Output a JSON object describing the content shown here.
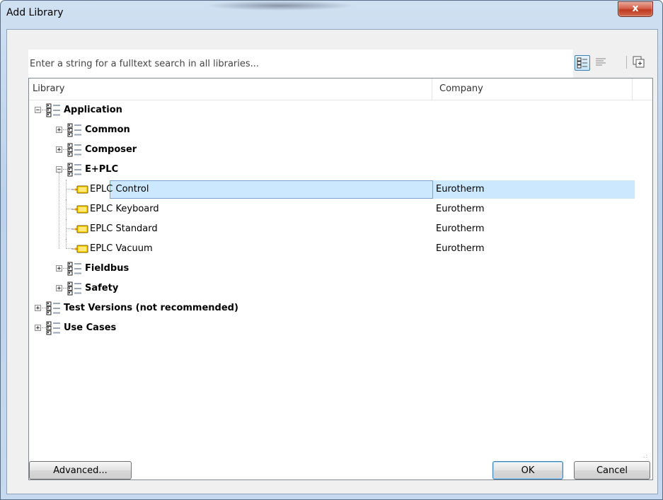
{
  "window": {
    "title": "Add Library",
    "close_glyph": "x"
  },
  "search": {
    "placeholder": "Enter a string for a fulltext search in all libraries..."
  },
  "toolbar": {
    "buttons": [
      {
        "icon": "category-view-icon",
        "active": true
      },
      {
        "icon": "list-view-icon",
        "active": false
      },
      {
        "icon": "expand-all-icon",
        "active": false
      }
    ]
  },
  "list": {
    "columns": [
      "Library",
      "Company"
    ],
    "rows": [
      {
        "label": "Application",
        "level": 0,
        "type": "folder",
        "expander": "minus",
        "company": ""
      },
      {
        "label": "Common",
        "level": 1,
        "type": "folder",
        "expander": "plus",
        "company": ""
      },
      {
        "label": "Composer",
        "level": 1,
        "type": "folder",
        "expander": "plus",
        "company": ""
      },
      {
        "label": "E+PLC",
        "level": 1,
        "type": "folder",
        "expander": "minus",
        "company": ""
      },
      {
        "label": "EPLC Control",
        "level": 2,
        "type": "library",
        "company": "Eurotherm",
        "selected": true
      },
      {
        "label": "EPLC Keyboard",
        "level": 2,
        "type": "library",
        "company": "Eurotherm"
      },
      {
        "label": "EPLC Standard",
        "level": 2,
        "type": "library",
        "company": "Eurotherm"
      },
      {
        "label": "EPLC Vacuum",
        "level": 2,
        "type": "library",
        "company": "Eurotherm"
      },
      {
        "label": "Fieldbus",
        "level": 1,
        "type": "folder",
        "expander": "plus",
        "company": ""
      },
      {
        "label": "Safety",
        "level": 1,
        "type": "folder",
        "expander": "plus",
        "company": ""
      },
      {
        "label": "Test Versions (not recommended)",
        "level": 0,
        "type": "folder",
        "expander": "plus",
        "company": ""
      },
      {
        "label": "Use Cases",
        "level": 0,
        "type": "folder",
        "expander": "plus",
        "company": ""
      }
    ]
  },
  "buttons": {
    "advanced": "Advanced...",
    "ok": "OK",
    "cancel": "Cancel"
  },
  "colors": {
    "selection": "#cce8ff",
    "title_gradient_top": "#cfe0f1",
    "close_button": "#c0381f"
  }
}
